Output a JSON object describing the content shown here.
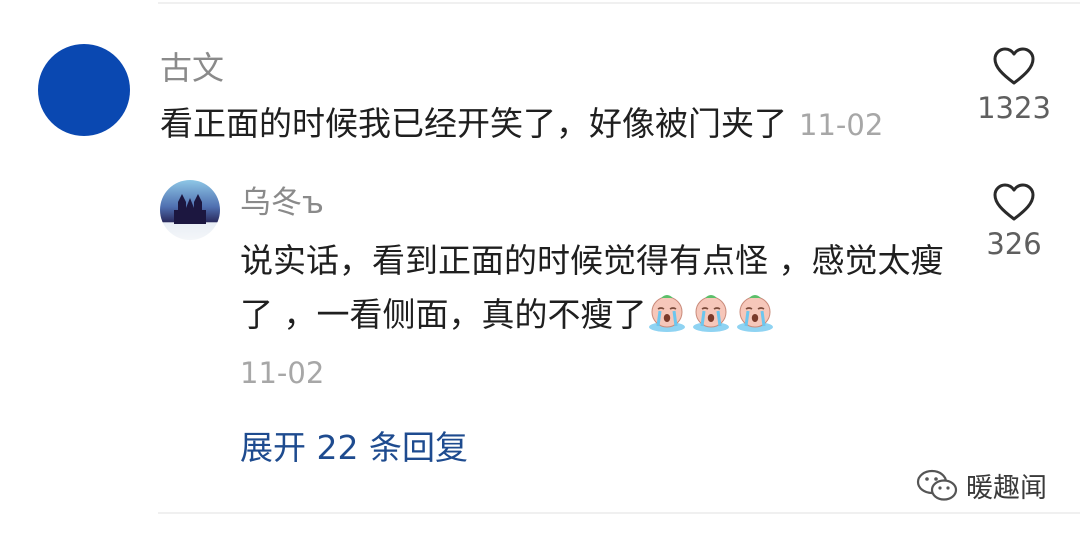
{
  "comment": {
    "author": "古文",
    "text": "看正面的时候我已经开笑了，好像被门夹了",
    "date": "11-02",
    "likes": "1323",
    "avatar_color": "#0a48b1"
  },
  "reply": {
    "author": "乌冬ъ",
    "text": "说实话，看到正面的时候觉得有点怪 ，感觉太瘦了 ，一看侧面，真的不瘦了",
    "emojis": [
      "crying-emoji",
      "crying-emoji",
      "crying-emoji"
    ],
    "date": "11-02",
    "likes": "326"
  },
  "expand_replies": "展开 22 条回复",
  "watermark": "暖趣闻",
  "icons": {
    "like": "heart-outline-icon",
    "watermark": "wechat-icon"
  },
  "colors": {
    "link": "#1e4b8f",
    "text": "#1f1f1f",
    "muted": "#a7a7a7"
  }
}
